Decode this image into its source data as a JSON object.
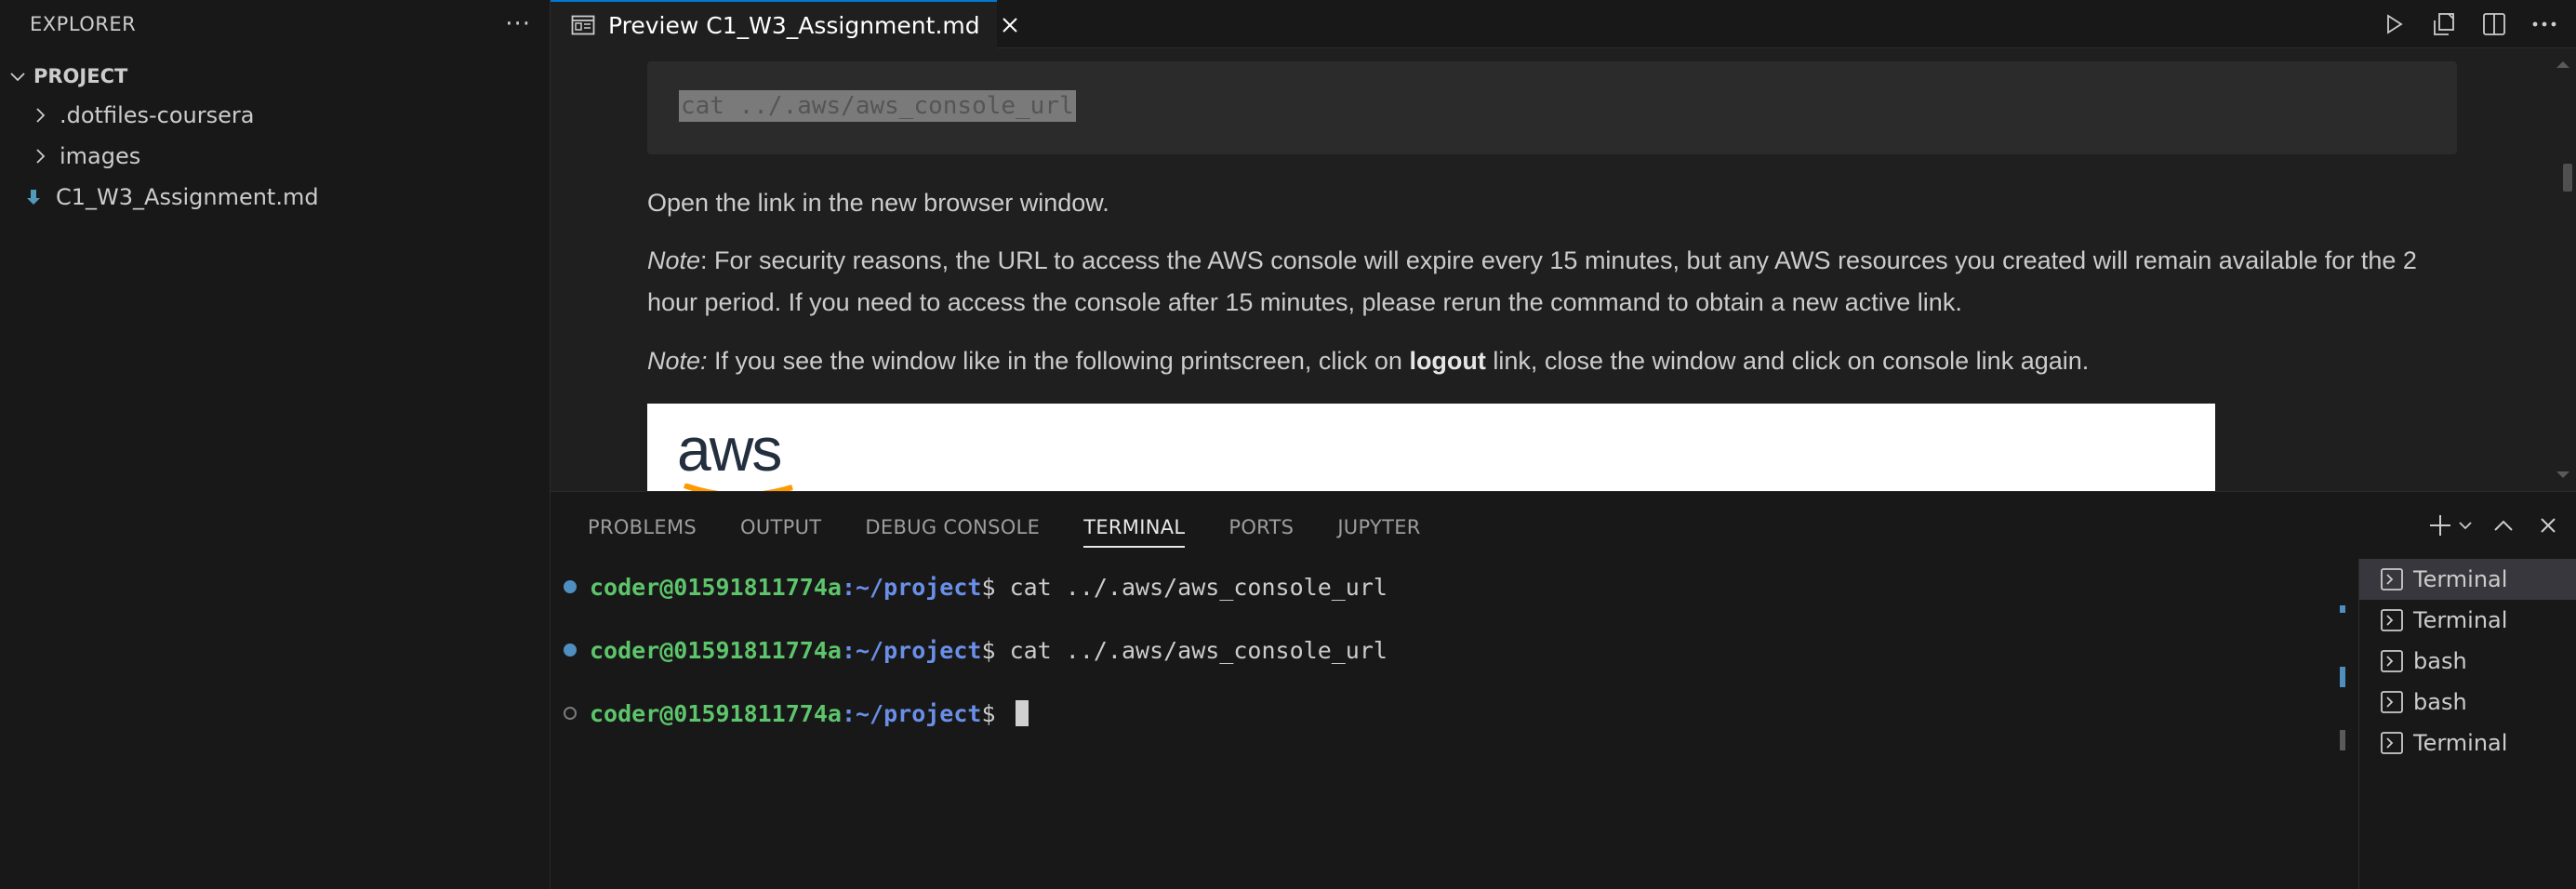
{
  "sidebar": {
    "title": "EXPLORER",
    "more": "···",
    "folder": "PROJECT",
    "items": [
      {
        "label": ".dotfiles-coursera",
        "icon": "chevron-right-icon"
      },
      {
        "label": "images",
        "icon": "chevron-right-icon"
      },
      {
        "label": "C1_W3_Assignment.md",
        "icon": "markdown-file-icon"
      }
    ]
  },
  "editor": {
    "tab_label": "Preview C1_W3_Assignment.md",
    "actions": [
      "run-icon",
      "open-changes-icon",
      "split-editor-icon",
      "more-actions-icon"
    ]
  },
  "preview": {
    "code": "cat ../.aws/aws_console_url",
    "p1": "Open the link in the new browser window.",
    "note_label": "Note",
    "p2_rest": ": For security reasons, the URL to access the AWS console will expire every 15 minutes, but any AWS resources you created will remain available for the 2 hour period. If you need to access the console after 15 minutes, please rerun the command to obtain a new active link.",
    "note_label2": "Note:",
    "p3_a": " If you see the window like in the following printscreen, click on ",
    "p3_bold": "logout",
    "p3_b": " link, close the window and click on console link again.",
    "image_logo": "aws"
  },
  "panel": {
    "tabs": [
      "PROBLEMS",
      "OUTPUT",
      "DEBUG CONSOLE",
      "TERMINAL",
      "PORTS",
      "JUPYTER"
    ],
    "active_tab": "TERMINAL",
    "terminal_lines": [
      {
        "user": "coder@01591811774a",
        "path": ":~/project",
        "prompt": "$ ",
        "cmd": "cat ../.aws/aws_console_url"
      },
      {
        "user": "coder@01591811774a",
        "path": ":~/project",
        "prompt": "$ ",
        "cmd": "cat ../.aws/aws_console_url"
      },
      {
        "user": "coder@01591811774a",
        "path": ":~/project",
        "prompt": "$ ",
        "cmd": ""
      }
    ],
    "terminals": [
      "Terminal",
      "Terminal",
      "bash",
      "bash",
      "Terminal"
    ]
  },
  "colors": {
    "accent": "#0078d4",
    "prompt_user": "#5dc56b",
    "prompt_path": "#6a8fe8"
  }
}
